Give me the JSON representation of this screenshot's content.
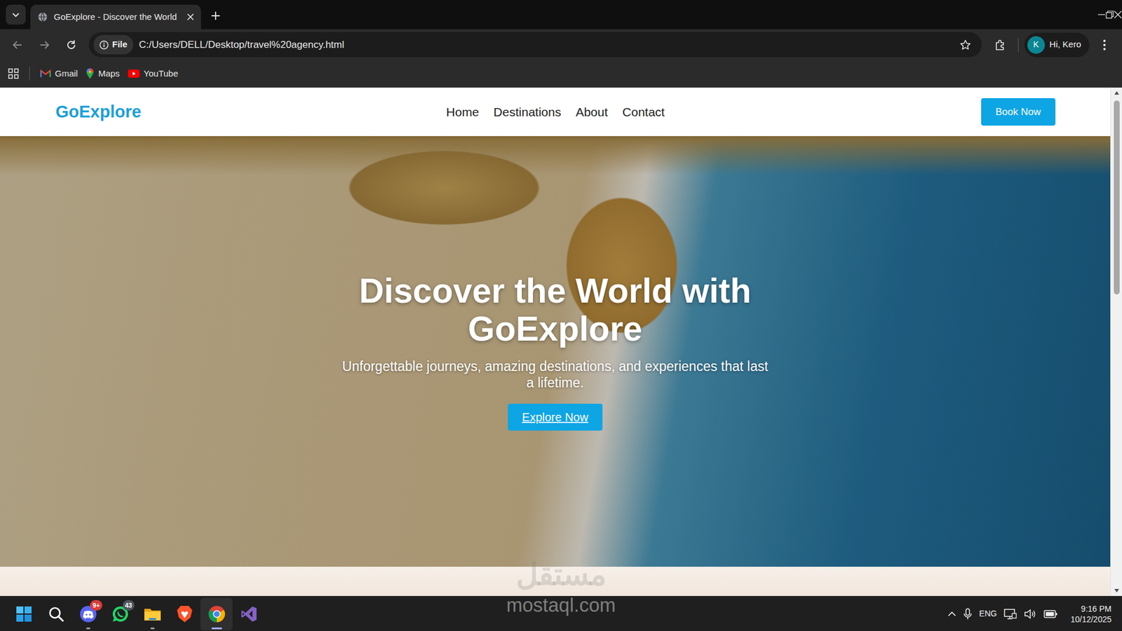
{
  "browser": {
    "tabs": [
      {
        "title": "GoExplore - Discover the World",
        "selected": true
      }
    ],
    "address": {
      "chip": "File",
      "url": "C:/Users/DELL/Desktop/travel%20agency.html"
    },
    "profile": {
      "initial": "K",
      "label": "Hi, Kero"
    },
    "bookmarks": [
      {
        "label": "Gmail",
        "kind": "gmail"
      },
      {
        "label": "Maps",
        "kind": "maps"
      },
      {
        "label": "YouTube",
        "kind": "youtube"
      }
    ]
  },
  "page": {
    "brand": "GoExplore",
    "nav": [
      {
        "label": "Home"
      },
      {
        "label": "Destinations"
      },
      {
        "label": "About"
      },
      {
        "label": "Contact"
      }
    ],
    "cta": "Book Now",
    "hero": {
      "title": "Discover the World with GoExplore",
      "subtitle": "Unforgettable journeys, amazing destinations, and experiences that last a lifetime.",
      "button": "Explore Now"
    },
    "scrollbar": {
      "level": 0.4
    }
  },
  "taskbar": {
    "apps": [
      {
        "kind": "start",
        "running": false,
        "selected": false
      },
      {
        "kind": "search",
        "running": false,
        "selected": false
      },
      {
        "kind": "discord",
        "running": true,
        "selected": false,
        "badge": "9+",
        "badge_color": "#d93a3a"
      },
      {
        "kind": "whatsapp",
        "running": false,
        "selected": false,
        "badge": "43",
        "badge_color": "#4f5560"
      },
      {
        "kind": "files",
        "running": true,
        "selected": false
      },
      {
        "kind": "brave",
        "running": false,
        "selected": false
      },
      {
        "kind": "chrome",
        "running": true,
        "selected": true
      },
      {
        "kind": "vstudio",
        "running": false,
        "selected": false
      }
    ],
    "tray": {
      "language": "ENG",
      "time": "9:16 PM",
      "date": "10/12/2025"
    }
  },
  "watermark": {
    "logo": "مستقل",
    "text": "mostaql.com"
  }
}
